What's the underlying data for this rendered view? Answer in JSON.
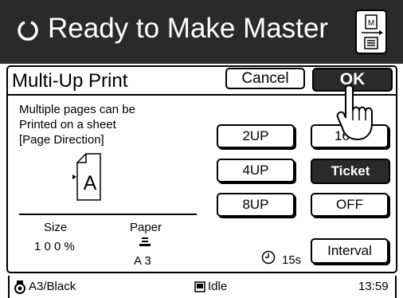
{
  "header": {
    "title": "Ready to Make Master"
  },
  "panel": {
    "title": "Multi-Up Print",
    "cancel_label": "Cancel",
    "ok_label": "OK",
    "description": [
      "Multiple pages can be",
      "Printed on a sheet",
      "[Page Direction]"
    ],
    "page_letter": "A",
    "size_label": "Size",
    "size_value": "1 0 0 %",
    "paper_label": "Paper",
    "paper_value": "A 3",
    "timer_value": "15s",
    "buttons": {
      "up2": "2UP",
      "up4": "4UP",
      "up8": "8UP",
      "up16": "16",
      "ticket": "Ticket",
      "off": "OFF",
      "interval": "Interval"
    }
  },
  "status": {
    "ink": "A3/Black",
    "machine": "Idle",
    "time": "13:59"
  }
}
